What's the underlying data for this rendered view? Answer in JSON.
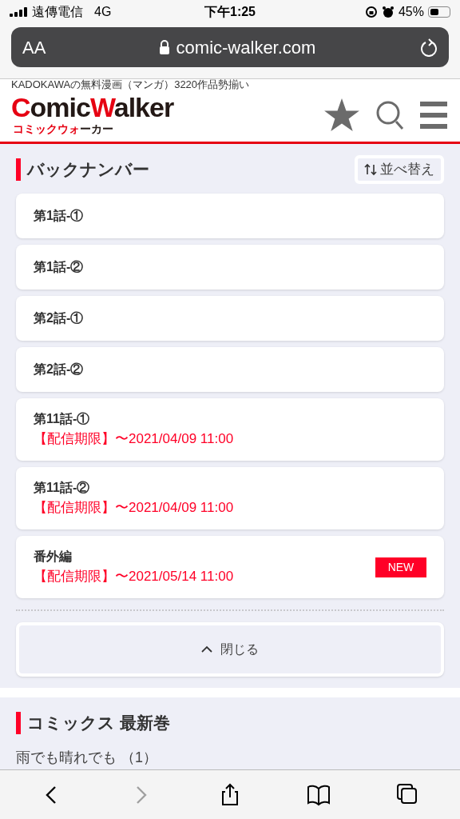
{
  "status_bar": {
    "carrier": "遠傳電信",
    "network": "4G",
    "time": "下午1:25",
    "battery": "45%"
  },
  "address_bar": {
    "text_size": "AA",
    "url": "comic-walker.com"
  },
  "header": {
    "tagline": "KADOKAWAの無料漫画（マンガ）3220作品勢揃い",
    "logo_parts": [
      {
        "text": "C",
        "accent": true
      },
      {
        "text": "omic",
        "accent": false
      },
      {
        "text": "W",
        "accent": true
      },
      {
        "text": "alker",
        "accent": false
      }
    ],
    "logo_sub_parts": [
      {
        "text": "コミックウォ",
        "accent": true
      },
      {
        "text": "ーカー",
        "accent": false
      }
    ]
  },
  "back_numbers": {
    "title": "バックナンバー",
    "sort_button": "並べ替え",
    "episodes": [
      {
        "title": "第1話-①"
      },
      {
        "title": "第1話-②"
      },
      {
        "title": "第2話-①"
      },
      {
        "title": "第2話-②"
      },
      {
        "title": "第11話-①",
        "deadline": "【配信期限】〜2021/04/09 11:00"
      },
      {
        "title": "第11話-②",
        "deadline": "【配信期限】〜2021/04/09 11:00"
      },
      {
        "title": "番外編",
        "deadline": "【配信期限】〜2021/05/14 11:00",
        "badge": "NEW"
      }
    ],
    "close_button": "閉じる"
  },
  "comics": {
    "title": "コミックス 最新巻",
    "item": "雨でも晴れでも （1）"
  },
  "toolbar": [
    {
      "kind": "back",
      "disabled": false
    },
    {
      "kind": "forward",
      "disabled": true
    },
    {
      "kind": "share",
      "disabled": false
    },
    {
      "kind": "bookmarks",
      "disabled": false
    },
    {
      "kind": "tabs",
      "disabled": false
    }
  ]
}
